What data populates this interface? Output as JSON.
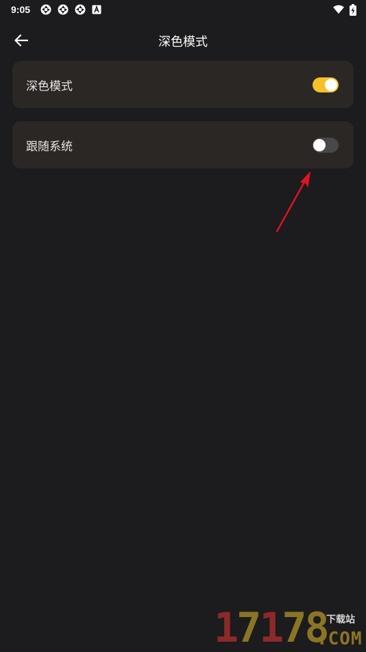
{
  "status_bar": {
    "time": "9:05",
    "notification_icons": [
      "aperture-icon",
      "aperture-icon",
      "aperture-icon",
      "font-a-icon"
    ],
    "right_icons": [
      "wifi-icon",
      "battery-charging-icon"
    ]
  },
  "app_bar": {
    "back_icon": "arrow-left-icon",
    "title": "深色模式"
  },
  "settings": [
    {
      "label": "深色模式",
      "enabled": true
    },
    {
      "label": "跟随系统",
      "enabled": false
    }
  ],
  "colors": {
    "background": "#1c1b1d",
    "card": "#2a2725",
    "toggle_on": "#f3c229",
    "toggle_off": "#4a4748",
    "annotation_arrow": "#e0141e"
  },
  "watermark": {
    "digits_red": "1",
    "digits_gold_1": "7",
    "digits_red_2": "1",
    "digits_gold_2": "78",
    "site": "下载站",
    "domain": ".COM"
  }
}
